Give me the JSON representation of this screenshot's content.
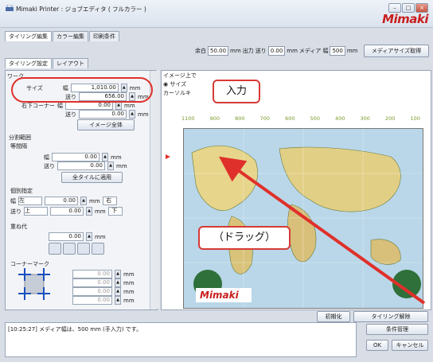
{
  "window": {
    "title": "Mimaki Printer : ジョブエディタ ( フルカラー )",
    "logo_text": "Mimaki",
    "buttons": [
      "–",
      "□",
      "×"
    ]
  },
  "top_tabs": [
    {
      "label": "タイリング編集",
      "active": true
    },
    {
      "label": "カラー編集",
      "active": false
    },
    {
      "label": "印刷条件",
      "active": false
    }
  ],
  "media_row": {
    "margin_label": "余白",
    "margin_value": "50.00",
    "margin_unit": "mm",
    "output_label": "出力",
    "feed_label": "送り",
    "feed_value": "0.00",
    "feed_unit": "mm",
    "media_label": "メディア",
    "width_label": "幅",
    "width_value": "500",
    "width_unit": "mm",
    "get_button": "メディアサイズ取得"
  },
  "sub_tabs": [
    {
      "label": "タイリング設定",
      "active": true
    },
    {
      "label": "レイアウト",
      "active": false
    }
  ],
  "left_panel": {
    "section_work": "ワーク",
    "size_label": "サイズ",
    "width_label": "幅",
    "width_value": "1,010.00",
    "feed_label": "送り",
    "feed_value": "656.00",
    "unit": "mm",
    "right_corner_label": "右下コーナー",
    "right_corner_width_label": "幅",
    "right_corner_width_value": "0.00",
    "right_corner_feed_label": "送り",
    "right_corner_feed_value": "0.00",
    "image_all_button": "イメージ全体",
    "split_section": "分割範囲",
    "equal_split": "等間隔",
    "split_width_label": "幅",
    "split_width_value": "0.00",
    "split_feed_label": "送り",
    "split_feed_value": "0.00",
    "apply_all_button": "全タイルに適用",
    "individual_section": "個別指定",
    "ind_width_label": "幅",
    "ind_left": "左",
    "ind_width_value": "0.00",
    "ind_right": "右",
    "ind_feed_label": "送り",
    "ind_up": "上",
    "ind_feed_value": "0.00",
    "ind_down": "下",
    "overlap_section": "重ね代",
    "overlap_value": "0.00",
    "corner_mark_section": "コーナーマーク",
    "corner_values": [
      "0.00",
      "0.00",
      "0.00",
      "0.00"
    ]
  },
  "preview": {
    "image_label": "イメージ上で",
    "size_radio": "サイズ",
    "cursor_label": "カーソルキ",
    "ruler": [
      "1100",
      "900",
      "800",
      "700",
      "600",
      "500",
      "400",
      "300",
      "200",
      "100"
    ]
  },
  "annotations": {
    "input_label": "入力",
    "drag_label": "（ドラッグ）"
  },
  "bottom_buttons": {
    "reset": "初期化",
    "tiling_release": "タイリング解除",
    "condition": "条件管理",
    "ok": "OK",
    "cancel": "キャンセル"
  },
  "log": {
    "message": "[10:25:27] メディア幅は、500 mm (手入力) です。"
  },
  "colors": {
    "accent_red": "#d63a35",
    "logo_red": "#c81e1e"
  }
}
